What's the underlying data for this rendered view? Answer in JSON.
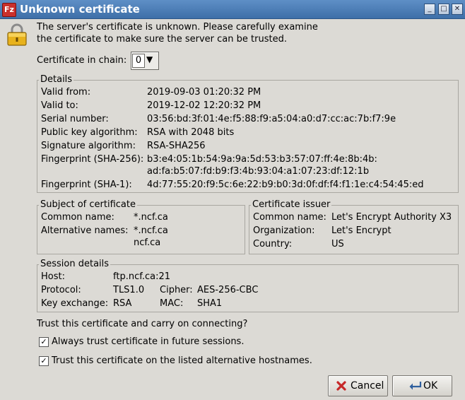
{
  "window": {
    "title": "Unknown certificate",
    "app_icon": "filezilla-icon",
    "controls": [
      "minimize",
      "maximize",
      "close"
    ]
  },
  "intro": {
    "line1": "The server's certificate is unknown. Please carefully examine",
    "line2": "the certificate to make sure the server can be trusted."
  },
  "chain": {
    "label": "Certificate in chain:",
    "value": "0"
  },
  "details": {
    "title": "Details",
    "valid_from_label": "Valid from:",
    "valid_from": "2019-09-03 01:20:32 PM",
    "valid_to_label": "Valid to:",
    "valid_to": "2019-12-02 12:20:32 PM",
    "serial_label": "Serial number:",
    "serial": "03:56:bd:3f:01:4e:f5:88:f9:a5:04:a0:d7:cc:ac:7b:f7:9e",
    "pubkey_label": "Public key algorithm:",
    "pubkey": "RSA with 2048 bits",
    "sigalg_label": "Signature algorithm:",
    "sigalg": "RSA-SHA256",
    "fp256_label": "Fingerprint (SHA-256):",
    "fp256_line1": "b3:e4:05:1b:54:9a:9a:5d:53:b3:57:07:ff:4e:8b:4b:",
    "fp256_line2": "ad:fa:b5:07:fd:b9:f3:4b:93:04:a1:07:23:df:12:1b",
    "fp1_label": "Fingerprint (SHA-1):",
    "fp1": "4d:77:55:20:f9:5c:6e:22:b9:b0:3d:0f:df:f4:f1:1e:c4:54:45:ed"
  },
  "subject": {
    "title": "Subject of certificate",
    "cn_label": "Common name:",
    "cn": "*.ncf.ca",
    "alt_label": "Alternative names:",
    "alt1": "*.ncf.ca",
    "alt2": "ncf.ca"
  },
  "issuer": {
    "title": "Certificate issuer",
    "cn_label": "Common name:",
    "cn": "Let's Encrypt Authority X3",
    "org_label": "Organization:",
    "org": "Let's Encrypt",
    "country_label": "Country:",
    "country": "US"
  },
  "session": {
    "title": "Session details",
    "host_label": "Host:",
    "host": "ftp.ncf.ca:21",
    "protocol_label": "Protocol:",
    "protocol": "TLS1.0",
    "cipher_label": "Cipher:",
    "cipher": "AES-256-CBC",
    "kex_label": "Key exchange:",
    "kex": "RSA",
    "mac_label": "MAC:",
    "mac": "SHA1"
  },
  "trust": {
    "question": "Trust this certificate and carry on connecting?",
    "always_label": "Always trust certificate in future sessions.",
    "always_checked": true,
    "alt_label": "Trust this certificate on the listed alternative hostnames.",
    "alt_checked": true
  },
  "buttons": {
    "cancel": "Cancel",
    "ok": "OK"
  },
  "colors": {
    "titlebar": "#3e6fa8",
    "window_bg": "#dcdad5"
  }
}
